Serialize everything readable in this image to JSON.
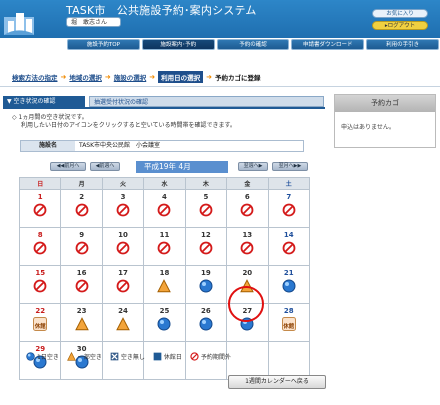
{
  "header": {
    "title": "TASK市　公共施設予約･案内システム",
    "user": "堀　敢志さん",
    "favorites_label": "お気に入り",
    "logout_label": "ログアウト"
  },
  "nav": [
    {
      "label": "施設予約TOP",
      "active": false
    },
    {
      "label": "施設案内･予約",
      "active": true
    },
    {
      "label": "予約の確認",
      "active": false
    },
    {
      "label": "申請書ダウンロード",
      "active": false
    },
    {
      "label": "利用の手引き",
      "active": false
    }
  ],
  "breadcrumbs": [
    "検索方法の指定",
    "地域の選択",
    "施設の選択",
    "利用日の選択",
    "予約カゴに登録"
  ],
  "tabs": {
    "availability": "空き状況の確認",
    "application": "抽選受付状況の確認"
  },
  "note_line1": "1ヵ月間の空き状況です。",
  "note_line2": "利用したい日付のアイコンをクリックすると空いている時間帯を確認できます。",
  "facility": {
    "label": "施設名",
    "value": "TASK市中央公民館　小会議室"
  },
  "month_nav": {
    "prev_month": "前月へ",
    "prev_week": "前週へ",
    "month": "平成19年 4月",
    "next_week": "翌週へ",
    "next_month": "翌月へ"
  },
  "weekdays": [
    "日",
    "月",
    "火",
    "水",
    "木",
    "金",
    "土"
  ],
  "calendar": [
    [
      {
        "d": "1",
        "s": "out"
      },
      {
        "d": "2",
        "s": "out"
      },
      {
        "d": "3",
        "s": "out"
      },
      {
        "d": "4",
        "s": "out"
      },
      {
        "d": "5",
        "s": "out"
      },
      {
        "d": "6",
        "s": "out"
      },
      {
        "d": "7",
        "s": "out"
      }
    ],
    [
      {
        "d": "8",
        "s": "out"
      },
      {
        "d": "9",
        "s": "out"
      },
      {
        "d": "10",
        "s": "out"
      },
      {
        "d": "11",
        "s": "out"
      },
      {
        "d": "12",
        "s": "out"
      },
      {
        "d": "13",
        "s": "out"
      },
      {
        "d": "14",
        "s": "out"
      }
    ],
    [
      {
        "d": "15",
        "s": "out"
      },
      {
        "d": "16",
        "s": "out"
      },
      {
        "d": "17",
        "s": "out"
      },
      {
        "d": "18",
        "s": "partial"
      },
      {
        "d": "19",
        "s": "free"
      },
      {
        "d": "20",
        "s": "partial"
      },
      {
        "d": "21",
        "s": "free"
      }
    ],
    [
      {
        "d": "22",
        "s": "closed"
      },
      {
        "d": "23",
        "s": "partial"
      },
      {
        "d": "24",
        "s": "partial"
      },
      {
        "d": "25",
        "s": "free"
      },
      {
        "d": "26",
        "s": "free"
      },
      {
        "d": "27",
        "s": "free"
      },
      {
        "d": "28",
        "s": "closed"
      }
    ],
    [
      {
        "d": "29",
        "s": "free"
      },
      {
        "d": "30",
        "s": "free"
      },
      {
        "d": "",
        "s": ""
      },
      {
        "d": "",
        "s": ""
      },
      {
        "d": "",
        "s": ""
      },
      {
        "d": "",
        "s": ""
      },
      {
        "d": "",
        "s": ""
      }
    ]
  ],
  "closed_label": "休館",
  "legend": {
    "free": "1日空き",
    "partial": "一部空き",
    "full": "空き無し",
    "closed": "休館日",
    "out": "予約期間外"
  },
  "back_button": "1週間カレンダーへ戻る",
  "cart": {
    "title": "予約カゴ",
    "message": "申込はありません。"
  },
  "colors": {
    "primary": "#1f5a95",
    "highlight": "#e01010",
    "orange": "#f08a00"
  }
}
